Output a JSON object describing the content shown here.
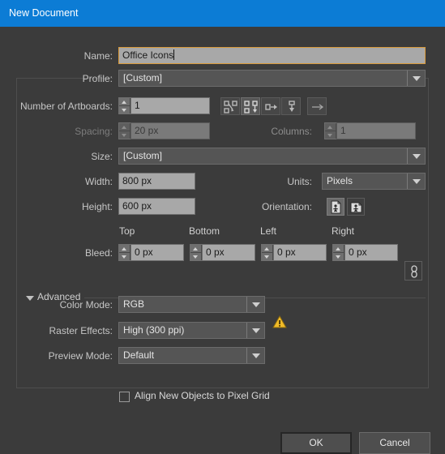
{
  "window": {
    "title": "New Document",
    "titlebar_color": "#0c7cd5",
    "background_color": "#3b3b3b"
  },
  "fields": {
    "name": {
      "label": "Name:",
      "value": "Office Icons",
      "focused": true
    },
    "profile": {
      "label": "Profile:",
      "value": "[Custom]"
    },
    "number_of_artboards": {
      "label": "Number of Artboards:",
      "value": "1"
    },
    "spacing": {
      "label": "Spacing:",
      "value": "20 px",
      "enabled": false
    },
    "columns": {
      "label": "Columns:",
      "value": "1",
      "enabled": false
    },
    "size": {
      "label": "Size:",
      "value": "[Custom]"
    },
    "width": {
      "label": "Width:",
      "value": "800 px"
    },
    "height": {
      "label": "Height:",
      "value": "600 px"
    },
    "units": {
      "label": "Units:",
      "value": "Pixels"
    },
    "orientation": {
      "label": "Orientation:",
      "portrait_icon": "portrait-page-icon",
      "landscape_icon": "landscape-page-icon",
      "selected": "portrait"
    },
    "bleed": {
      "label": "Bleed:",
      "columns": [
        "Top",
        "Bottom",
        "Left",
        "Right"
      ],
      "values": [
        "0 px",
        "0 px",
        "0 px",
        "0 px"
      ],
      "link_icon": "chain-link-icon",
      "linked": true
    },
    "color_mode": {
      "label": "Color Mode:",
      "value": "RGB",
      "warning_icon": "warning-triangle-icon",
      "warning_color": "#f0bb28"
    },
    "raster_effects": {
      "label": "Raster Effects:",
      "value": "High (300 ppi)"
    },
    "preview_mode": {
      "label": "Preview Mode:",
      "value": "Default"
    },
    "align_pixel_grid": {
      "label": "Align New Objects to Pixel Grid",
      "checked": false
    }
  },
  "artboard_layout_buttons": [
    {
      "name": "grid-by-row-icon",
      "selected": false
    },
    {
      "name": "grid-by-column-icon",
      "selected": true
    },
    {
      "name": "arrange-by-row-icon",
      "selected": false
    },
    {
      "name": "arrange-by-column-icon",
      "selected": false
    },
    {
      "name": "change-to-right-to-left-layout-icon",
      "selected": false
    }
  ],
  "advanced": {
    "label": "Advanced",
    "expanded": true,
    "disclosure_icon": "chevron-down-icon"
  },
  "buttons": {
    "ok": "OK",
    "cancel": "Cancel"
  }
}
